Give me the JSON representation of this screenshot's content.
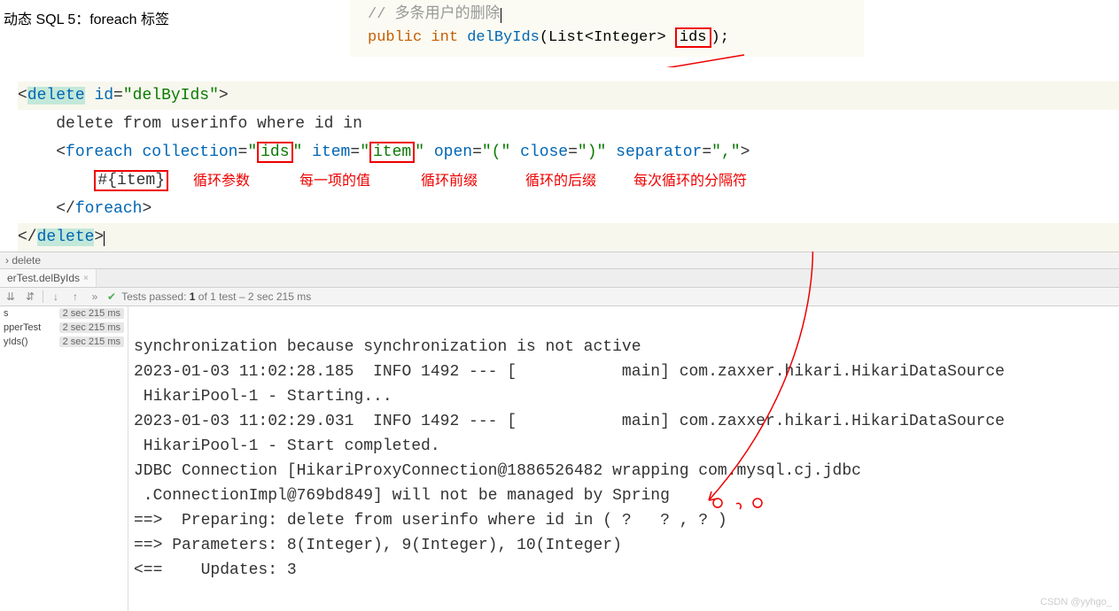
{
  "title": "动态 SQL 5：foreach 标签",
  "java": {
    "comment": "//  多条用户的删除",
    "kw_public": "public",
    "kw_int": "int",
    "method": "delByIds",
    "sig_pre": "(List<Integer> ",
    "param": "ids",
    "sig_post": ");"
  },
  "xml": {
    "open_tag": "delete",
    "attr_id": "id",
    "id_val": "\"delByIds\"",
    "delete_text": "delete from userinfo where id in",
    "fe_tag": "foreach",
    "attr_coll": "collection",
    "coll_val_l": "\"",
    "coll_val_mid": "ids",
    "coll_val_r": "\"",
    "attr_item": "item",
    "item_val_l": "\"",
    "item_val_mid": "item",
    "item_val_r": "\"",
    "attr_open": "open",
    "open_val": "\"(\"",
    "attr_close": "close",
    "close_val": "\")\"",
    "attr_sep": "separator",
    "sep_val": "\",\"",
    "hash": "#{item}"
  },
  "ann": {
    "a1": "循环参数",
    "a2": "每一项的值",
    "a3": "循环前缀",
    "a4": "循环的后缀",
    "a5": "每次循环的分隔符"
  },
  "breadcrumb": "›   delete",
  "tab": "erTest.delByIds",
  "tb_text_pre": "Tests passed: ",
  "tb_text_num": "1",
  "tb_text_post": " of 1 test – 2 sec 215 ms",
  "tests": [
    {
      "name": "s",
      "time": "2 sec 215 ms"
    },
    {
      "name": "pperTest",
      "time": "2 sec 215 ms"
    },
    {
      "name": "yIds()",
      "time": "2 sec 215 ms"
    }
  ],
  "console_lines": [
    "synchronization because synchronization is not active",
    "2023-01-03 11:02:28.185  INFO 1492 --- [           main] com.zaxxer.hikari.HikariDataSource",
    " HikariPool-1 - Starting...",
    "2023-01-03 11:02:29.031  INFO 1492 --- [           main] com.zaxxer.hikari.HikariDataSource",
    " HikariPool-1 - Start completed.",
    "JDBC Connection [HikariProxyConnection@1886526482 wrapping com.mysql.cj.jdbc",
    " .ConnectionImpl@769bd849] will not be managed by Spring",
    "==>  Preparing: delete from userinfo where id in ( ?   ? , ? )",
    "==> Parameters: 8(Integer), 9(Integer), 10(Integer)",
    "<==    Updates: 3"
  ],
  "watermark": "CSDN @yyhgo_"
}
